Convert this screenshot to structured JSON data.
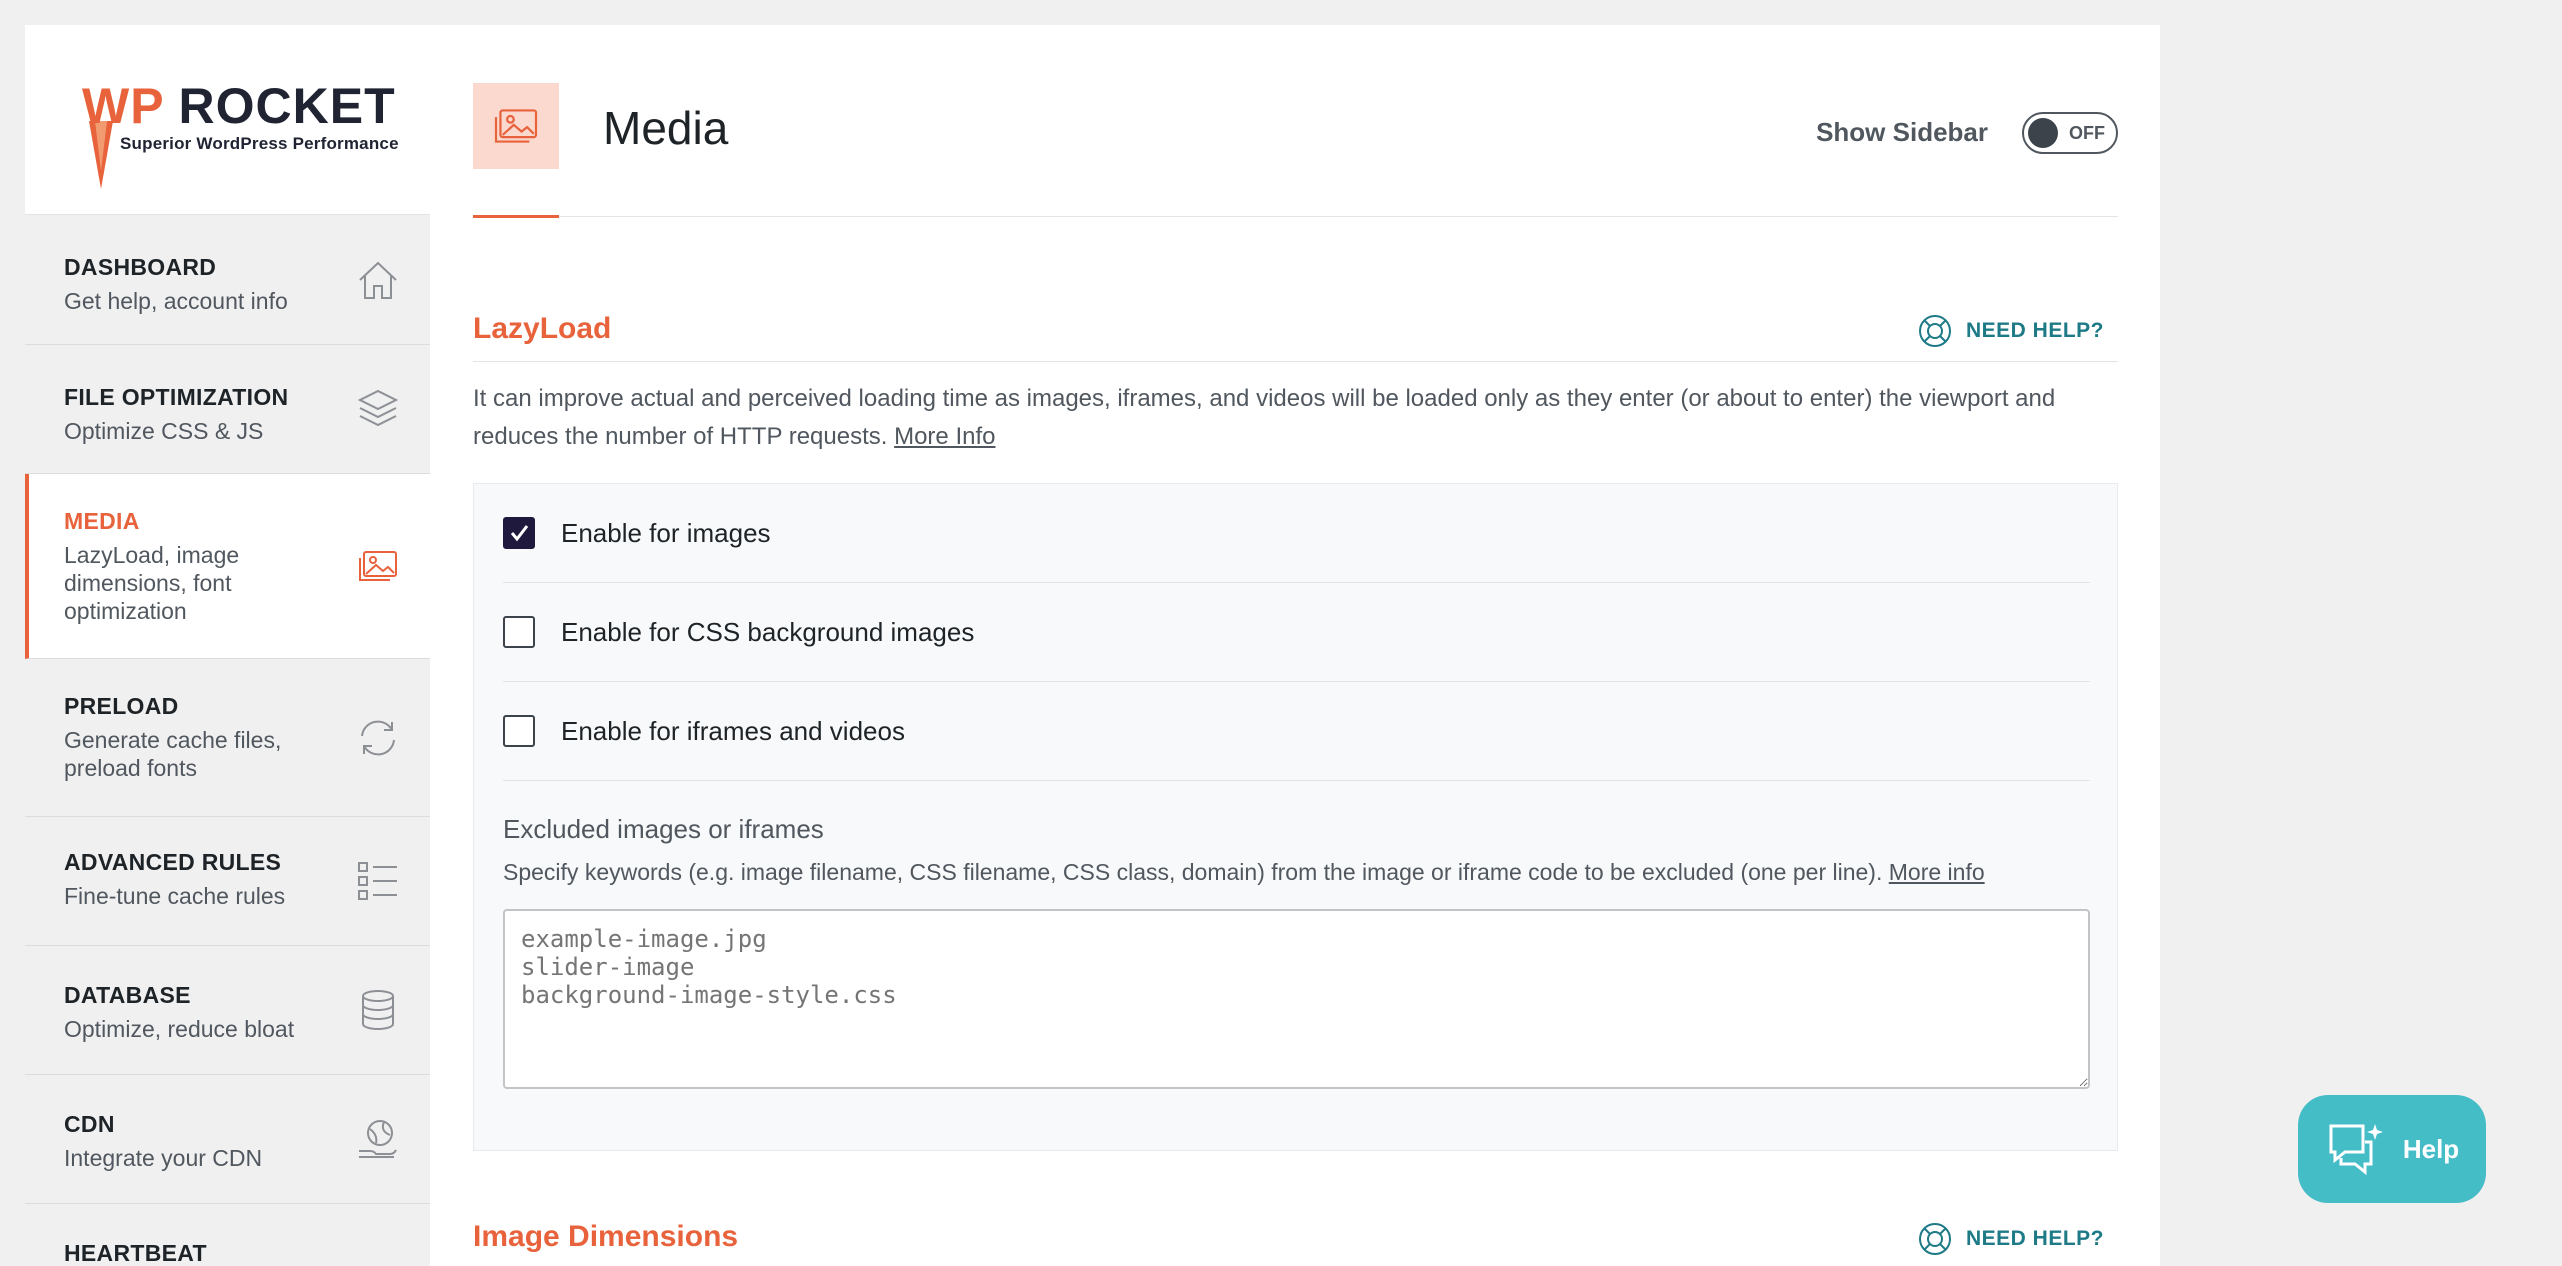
{
  "brand": {
    "name_prefix": "WP",
    "name_suffix": "ROCKET",
    "tagline": "Superior WordPress Performance",
    "accent": "#e8623b"
  },
  "sidebar": {
    "items": [
      {
        "title": "DASHBOARD",
        "desc": "Get help, account info",
        "icon": "home-icon"
      },
      {
        "title": "FILE OPTIMIZATION",
        "desc": "Optimize CSS & JS",
        "icon": "layers-icon"
      },
      {
        "title": "MEDIA",
        "desc": "LazyLoad, image dimensions, font optimization",
        "icon": "images-icon",
        "active": true
      },
      {
        "title": "PRELOAD",
        "desc": "Generate cache files, preload fonts",
        "icon": "refresh-icon"
      },
      {
        "title": "ADVANCED RULES",
        "desc": "Fine-tune cache rules",
        "icon": "checklist-icon"
      },
      {
        "title": "DATABASE",
        "desc": "Optimize, reduce bloat",
        "icon": "database-icon"
      },
      {
        "title": "CDN",
        "desc": "Integrate your CDN",
        "icon": "globe-hand-icon"
      },
      {
        "title": "HEARTBEAT",
        "desc": "",
        "icon": "heart-icon"
      }
    ]
  },
  "header": {
    "title": "Media",
    "show_sidebar_label": "Show Sidebar",
    "toggle_label": "OFF"
  },
  "lazyload": {
    "title": "LazyLoad",
    "need_help": "NEED HELP?",
    "intro": "It can improve actual and perceived loading time as images, iframes, and videos will be loaded only as they enter (or about to enter) the viewport and reduces the number of HTTP requests.",
    "intro_link": "More Info",
    "options": [
      {
        "label": "Enable for images",
        "checked": true
      },
      {
        "label": "Enable for CSS background images",
        "checked": false
      },
      {
        "label": "Enable for iframes and videos",
        "checked": false
      }
    ],
    "excluded_title": "Excluded images or iframes",
    "excluded_desc": "Specify keywords (e.g. image filename, CSS filename, CSS class, domain) from the image or iframe code to be excluded (one per line).",
    "excluded_link": "More info",
    "excluded_placeholder": "example-image.jpg\nslider-image\nbackground-image-style.css"
  },
  "image_dimensions": {
    "title": "Image Dimensions",
    "need_help": "NEED HELP?"
  },
  "help_button": {
    "label": "Help"
  }
}
